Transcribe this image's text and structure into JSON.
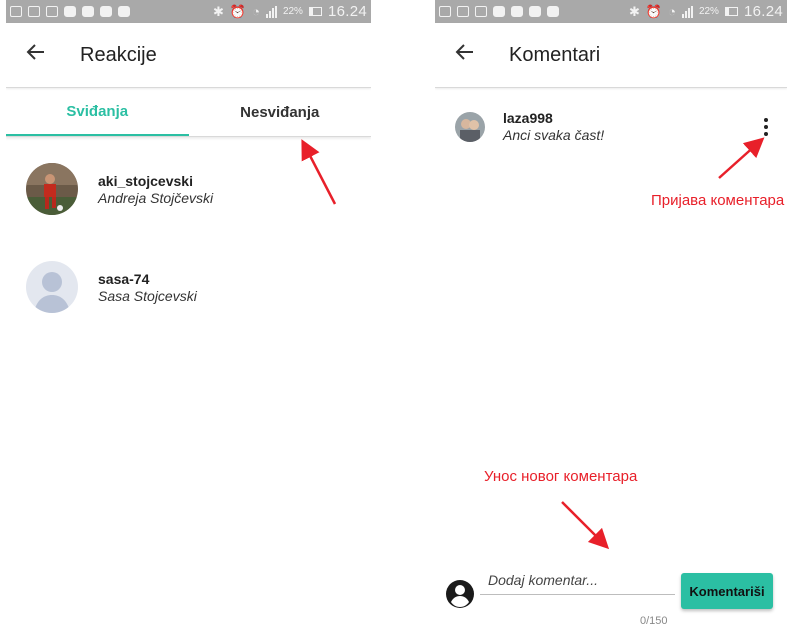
{
  "status_bar": {
    "battery": "22%",
    "time": "16.24"
  },
  "reactions_screen": {
    "title": "Reakcije",
    "tabs": [
      {
        "label": "Sviđanja",
        "active": true
      },
      {
        "label": "Nesviđanja",
        "active": false
      }
    ],
    "users": [
      {
        "username": "aki_stojcevski",
        "full_name": "Andreja Stojčevski",
        "avatar": "photo"
      },
      {
        "username": "sasa-74",
        "full_name": "Sasa Stojcevski",
        "avatar": "placeholder"
      }
    ]
  },
  "comments_screen": {
    "title": "Komentari",
    "comments": [
      {
        "username": "laza998",
        "text": "Anci svaka čast!"
      }
    ],
    "input": {
      "placeholder": "Dodaj komentar...",
      "counter": "0/150",
      "submit_label": "Komentariši"
    }
  },
  "annotations": {
    "report_comment": "Пријава коментара",
    "new_comment": "Унос новог коментара"
  },
  "colors": {
    "accent": "#2bbfa3",
    "annotation": "#e8202a",
    "status_bar": "#a9a9a9"
  },
  "icons": [
    "back-arrow-icon",
    "more-vert-icon",
    "account-circle-icon",
    "bluetooth-icon",
    "alarm-icon",
    "wifi-icon",
    "signal-icon",
    "battery-icon"
  ]
}
